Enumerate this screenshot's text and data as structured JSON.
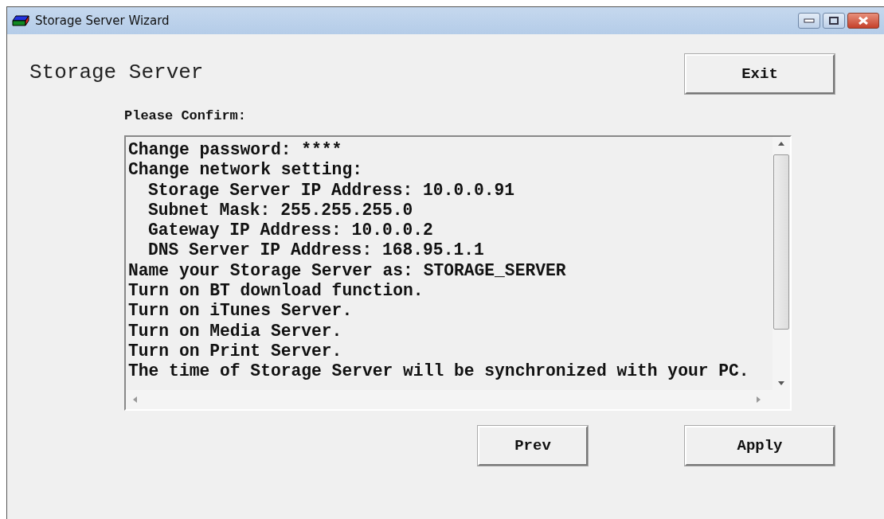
{
  "window": {
    "title": "Storage Server Wizard"
  },
  "heading": "Storage Server",
  "exit_button": "Exit",
  "prompt": "Please Confirm:",
  "summary_lines": [
    {
      "text": "Change password: ****"
    },
    {
      "text": "Change network setting:",
      "children": [
        {
          "text": "Storage Server IP Address: 10.0.0.91"
        },
        {
          "text": "Subnet Mask: 255.255.255.0"
        },
        {
          "text": "Gateway IP Address: 10.0.0.2"
        },
        {
          "text": "DNS Server IP Address: 168.95.1.1"
        }
      ]
    },
    {
      "text": "Name your Storage Server as: STORAGE_SERVER"
    },
    {
      "text": "Turn on BT download function."
    },
    {
      "text": "Turn on iTunes Server."
    },
    {
      "text": "Turn on Media Server."
    },
    {
      "text": "Turn on Print Server."
    },
    {
      "text": "The time of Storage Server will be synchronized with your PC."
    }
  ],
  "buttons": [
    "Prev",
    "Apply"
  ]
}
